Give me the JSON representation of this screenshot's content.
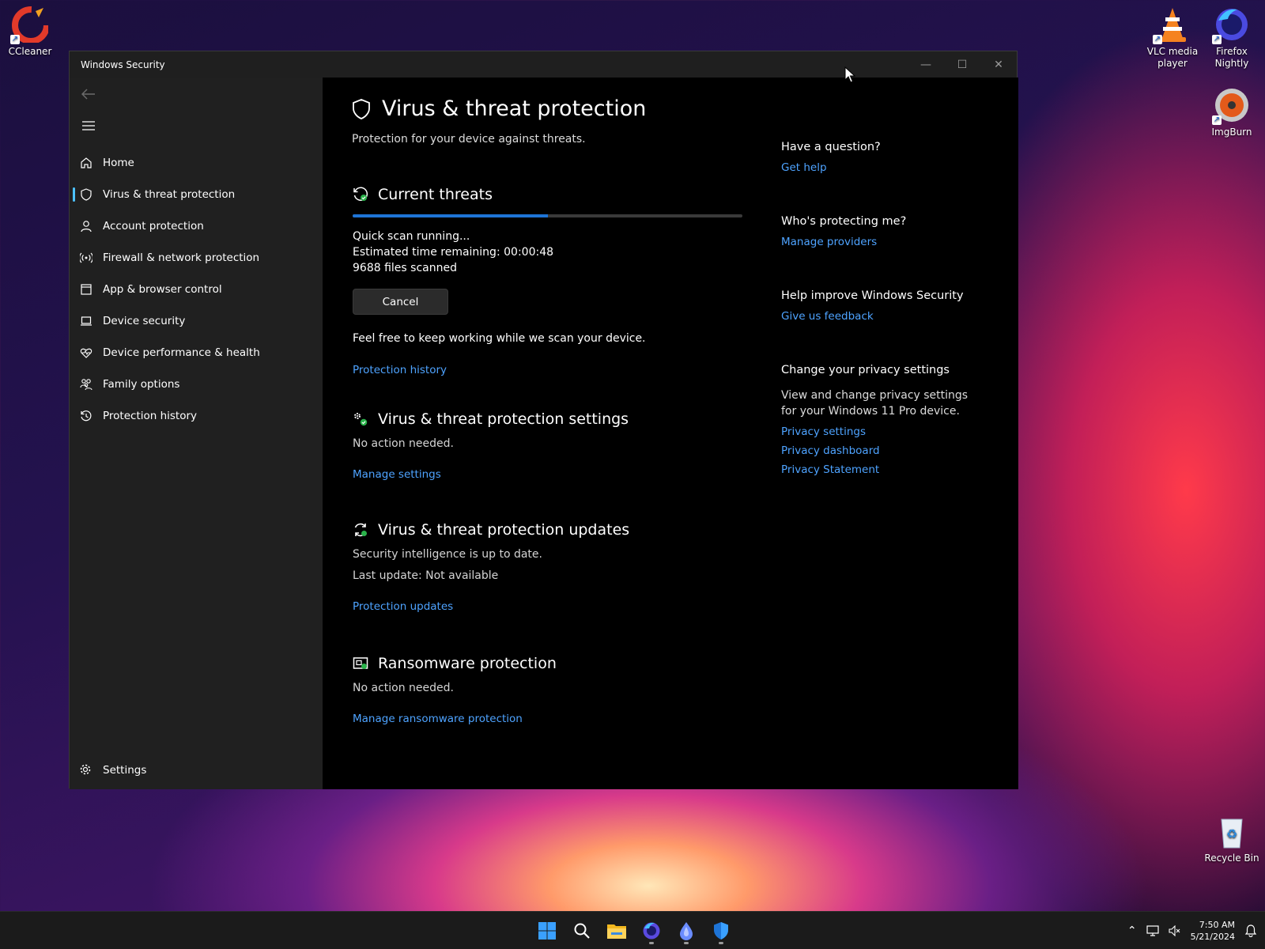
{
  "desktop": {
    "icons": [
      {
        "label": "CCleaner"
      },
      {
        "label": "VLC media player"
      },
      {
        "label": "Firefox Nightly"
      },
      {
        "label": "ImgBurn"
      },
      {
        "label": "Recycle Bin"
      }
    ]
  },
  "window": {
    "title": "Windows Security",
    "controls": {
      "minimize": "—",
      "maximize": "☐",
      "close": "✕"
    }
  },
  "sidebar": {
    "items": [
      {
        "label": "Home",
        "icon": "home-icon"
      },
      {
        "label": "Virus & threat protection",
        "icon": "shield-icon",
        "active": true
      },
      {
        "label": "Account protection",
        "icon": "person-icon"
      },
      {
        "label": "Firewall & network protection",
        "icon": "wireless-icon"
      },
      {
        "label": "App & browser control",
        "icon": "app-window-icon"
      },
      {
        "label": "Device security",
        "icon": "laptop-icon"
      },
      {
        "label": "Device performance & health",
        "icon": "heart-pulse-icon"
      },
      {
        "label": "Family options",
        "icon": "family-icon"
      },
      {
        "label": "Protection history",
        "icon": "history-icon"
      }
    ],
    "settings_label": "Settings"
  },
  "main": {
    "title": "Virus & threat protection",
    "subtitle": "Protection for your device against threats.",
    "current_threats": {
      "heading": "Current threats",
      "progress_percent": 50,
      "status": "Quick scan running...",
      "eta_label": "Estimated time remaining:",
      "eta_value": "00:00:48",
      "files_count": "9688",
      "files_label": "files scanned",
      "cancel_label": "Cancel",
      "note": "Feel free to keep working while we scan your device.",
      "history_link": "Protection history"
    },
    "settings_section": {
      "heading": "Virus & threat protection settings",
      "status": "No action needed.",
      "link": "Manage settings"
    },
    "updates_section": {
      "heading": "Virus & threat protection updates",
      "status": "Security intelligence is up to date.",
      "last_update": "Last update: Not available",
      "link": "Protection updates"
    },
    "ransomware_section": {
      "heading": "Ransomware protection",
      "status": "No action needed.",
      "link": "Manage ransomware protection"
    }
  },
  "right": {
    "question": {
      "heading": "Have a question?",
      "link": "Get help"
    },
    "protecting": {
      "heading": "Who's protecting me?",
      "link": "Manage providers"
    },
    "improve": {
      "heading": "Help improve Windows Security",
      "link": "Give us feedback"
    },
    "privacy": {
      "heading": "Change your privacy settings",
      "text": "View and change privacy settings for your Windows 11 Pro device.",
      "links": [
        "Privacy settings",
        "Privacy dashboard",
        "Privacy Statement"
      ]
    }
  },
  "taskbar": {
    "apps": [
      "start-icon",
      "search-icon",
      "file-explorer-icon",
      "firefox-icon",
      "app-icon",
      "windows-security-icon"
    ],
    "time": "7:50 AM",
    "date": "5/21/2024"
  },
  "colors": {
    "accent": "#4ea3ff",
    "progress": "#1e74d6",
    "nav_indicator": "#4cc2ff"
  }
}
